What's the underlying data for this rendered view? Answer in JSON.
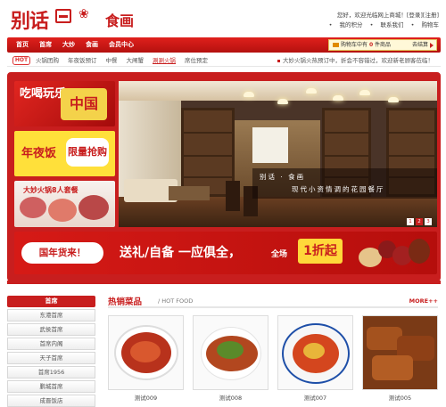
{
  "header": {
    "logo_main": "别话",
    "logo_name": "食画",
    "top_links": {
      "welcome": "您好，欢迎光临网上商城！",
      "login": "[登录]",
      "register": "[注册]",
      "my_points": "我的积分",
      "contact": "联系我们",
      "shopping_cart": "购物车"
    }
  },
  "nav": {
    "items": [
      "首页",
      "首席",
      "大炒",
      "食画",
      "会员中心"
    ],
    "cart_text": "购物车中有",
    "cart_count": "0",
    "cart_unit": "件商品",
    "checkout": "去结算"
  },
  "subnav": {
    "hot": "HOT",
    "items": [
      "火锅团购",
      "年夜饭预订",
      "中餐",
      "大闸蟹",
      "涮涮火锅",
      "席位预定"
    ],
    "active_index": 4,
    "announcement": "大妙火锅火热预订中，折会不容错过，欢迎新老顾客莅临！"
  },
  "banner": {
    "promo1": "吃喝玩乐",
    "promo1_cn": "中国",
    "promo2_a": "年夜饭",
    "promo2_b": "限量抢购",
    "promo3": "大妙火锅8人套餐",
    "caption_line1": "别话 · 食画",
    "caption_line2": "现代小资情调的花园餐厅",
    "slides": [
      "1",
      "2",
      "3"
    ],
    "active_slide": 2,
    "wide_left": "国年货来！",
    "wide_main": "送礼/自备 一应俱全，",
    "wide_sub": "全场",
    "wide_off": "1折起"
  },
  "sidebar": {
    "title": "首席",
    "items": [
      "东港首席",
      "武侯首席",
      "首席内阁",
      "天子首席",
      "首席1956",
      "鹏城首席",
      "成晋饭店"
    ]
  },
  "hot_food": {
    "title": "热销菜品",
    "subtitle": "/ HOT FOOD",
    "more": "MORE++",
    "items": [
      "测试009",
      "测试008",
      "测试007",
      "测试005"
    ]
  },
  "colors": {
    "brand_red": "#c81e1e",
    "accent_yellow": "#ffd83a"
  }
}
